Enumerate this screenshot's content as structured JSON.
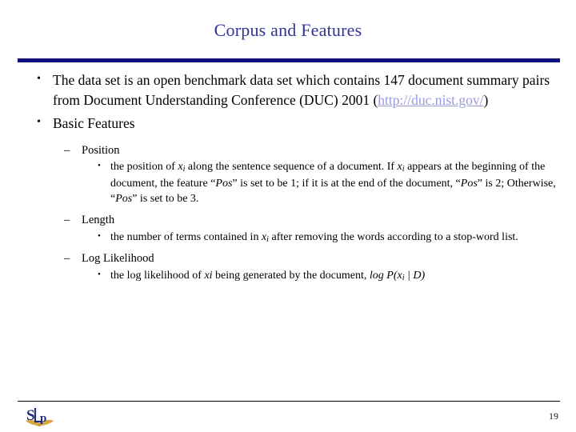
{
  "slide": {
    "title": "Corpus and Features",
    "title_color": "#333399",
    "rule_color": "#101080",
    "page_number": "19",
    "logo_name": "slp-logo",
    "logo_colors": {
      "letters": "#1f2f7a",
      "book": "#d9a441"
    }
  },
  "bullets": {
    "b1": {
      "marker": "•",
      "line1": "The data set is an open benchmark data set which contains 147",
      "line2": "document summary pairs from Document Understanding",
      "line3_pre": "Conference (DUC) 2001 (",
      "link": "http://duc.nist.gov/",
      "link_color": "#9a9ae0",
      "line3_post": ")"
    },
    "b2": {
      "marker": "•",
      "text": "Basic Features"
    },
    "position": {
      "dash": "–",
      "label": "Position",
      "detail": {
        "marker": "•",
        "t1": "the position of ",
        "var1": "x",
        "var1_sub": "i",
        "t2": " along the sentence sequence of a document. If ",
        "var2": "x",
        "var2_sub": "i",
        "t3": " appears at the beginning of the document, the feature “",
        "feat1": "Pos",
        "t4": "” is set to be 1; if it is at the end of the document, “",
        "feat2": "Pos",
        "t5": "” is 2; Otherwise, “",
        "feat3": "Pos",
        "t6": "” is set to be 3."
      }
    },
    "length": {
      "dash": "–",
      "label": "Length",
      "detail": {
        "marker": "•",
        "t1": "the number of terms contained in ",
        "var1": "x",
        "var1_sub": "i",
        "t2": " after removing the words according to a stop-word list."
      }
    },
    "log_likelihood": {
      "dash": "–",
      "label": "Log Likelihood",
      "detail": {
        "marker": "•",
        "t1": "the log likelihood of ",
        "var1": "xi",
        "t2": " being generated by the document, ",
        "formula_pre": "log P(",
        "formula_var": "x",
        "formula_sub": "i",
        "formula_post": " | D)"
      }
    }
  }
}
